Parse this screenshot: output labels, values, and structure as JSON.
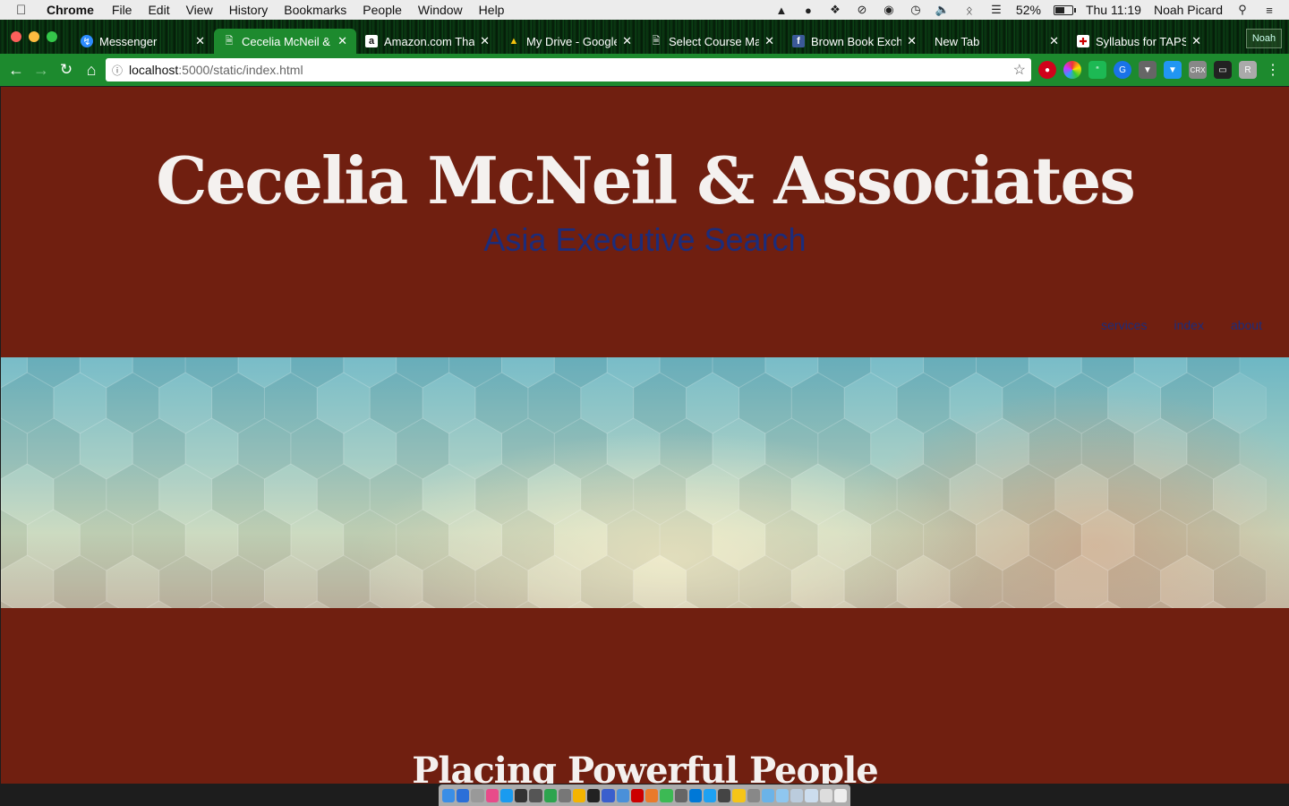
{
  "menubar": {
    "app_name": "Chrome",
    "items": [
      "File",
      "Edit",
      "View",
      "History",
      "Bookmarks",
      "People",
      "Window",
      "Help"
    ],
    "battery": "52%",
    "clock": "Thu 11:19",
    "user": "Noah Picard"
  },
  "tabs": [
    {
      "title": "Messenger",
      "icon": "messenger-icon",
      "active": false
    },
    {
      "title": "Cecelia McNeil & A",
      "icon": "page-icon",
      "active": true
    },
    {
      "title": "Amazon.com Thank",
      "icon": "amazon-icon",
      "active": false
    },
    {
      "title": "My Drive - Google",
      "icon": "drive-icon",
      "active": false
    },
    {
      "title": "Select Course Mat",
      "icon": "page-icon",
      "active": false
    },
    {
      "title": "Brown Book Excha",
      "icon": "facebook-icon",
      "active": false
    },
    {
      "title": "New Tab",
      "icon": "none",
      "active": false
    },
    {
      "title": "Syllabus for TAPS",
      "icon": "shield-icon",
      "active": false
    }
  ],
  "profile_chip": "Noah",
  "omnibox": {
    "host": "localhost",
    "path": ":5000/static/index.html"
  },
  "page": {
    "title": "Cecelia McNeil & Associates",
    "subtitle": "Asia Executive Search",
    "nav": [
      "services",
      "index",
      "about"
    ],
    "tagline": "Placing Powerful People"
  },
  "colors": {
    "page_bg": "#701f10",
    "subtitle": "#1c2c7a",
    "chrome_toolbar": "#1d8a2e"
  }
}
